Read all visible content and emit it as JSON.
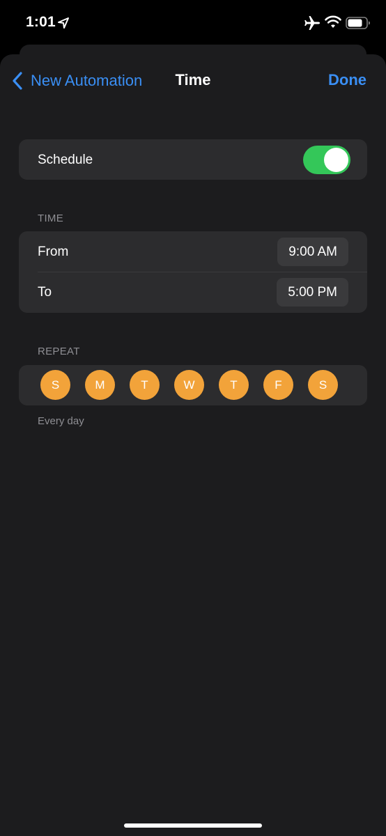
{
  "status_bar": {
    "time": "1:01",
    "icons": [
      "location-icon",
      "airplane-icon",
      "wifi-icon",
      "battery-icon"
    ]
  },
  "nav": {
    "back_label": "New Automation",
    "title": "Time",
    "done_label": "Done"
  },
  "schedule": {
    "label": "Schedule",
    "enabled": true
  },
  "time_section": {
    "header": "TIME",
    "from_label": "From",
    "from_value": "9:00 AM",
    "to_label": "To",
    "to_value": "5:00 PM"
  },
  "repeat_section": {
    "header": "REPEAT",
    "days": [
      {
        "letter": "S",
        "selected": true
      },
      {
        "letter": "M",
        "selected": true
      },
      {
        "letter": "T",
        "selected": true
      },
      {
        "letter": "W",
        "selected": true
      },
      {
        "letter": "T",
        "selected": true
      },
      {
        "letter": "F",
        "selected": true
      },
      {
        "letter": "S",
        "selected": true
      }
    ],
    "footer": "Every day"
  },
  "colors": {
    "accent_blue": "#3a8ff5",
    "toggle_on": "#34c759",
    "day_selected": "#f2a33a",
    "background": "#1c1c1e",
    "cell": "#2c2c2e"
  }
}
